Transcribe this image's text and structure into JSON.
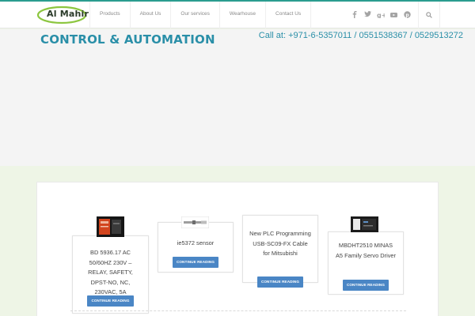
{
  "header": {
    "logo_text": "Al Mahir",
    "nav": [
      "Products",
      "About Us",
      "Our services",
      "Wearhouse",
      "Contact Us"
    ],
    "social": [
      "facebook-icon",
      "twitter-icon",
      "google-plus-icon",
      "youtube-icon",
      "pinterest-icon"
    ],
    "search_icon": "search-icon"
  },
  "hero": {
    "title": "CONTROL & AUTOMATION",
    "call": "Call at: +971-6-5357011 / 0551538367 / 0529513272"
  },
  "products": [
    {
      "title": "BD 5936.17 AC 50/60HZ 230V – RELAY, SAFETY, DPST-NO, NC, 230VAC, 5A",
      "button": "CONTINUE READING"
    },
    {
      "title": "ie5372 sensor",
      "button": "CONTINUE READING"
    },
    {
      "title": "New PLC Programming USB-SC09-FX Cable for Mitsubishi",
      "button": "CONTINUE READING"
    },
    {
      "title": "MBDHT2510 MINAS A5 Family Servo Driver",
      "button": "CONTINUE READING"
    }
  ],
  "colors": {
    "accent": "#2a8fa8",
    "button": "#4a86c5",
    "top_line": "#2a9c8f"
  }
}
